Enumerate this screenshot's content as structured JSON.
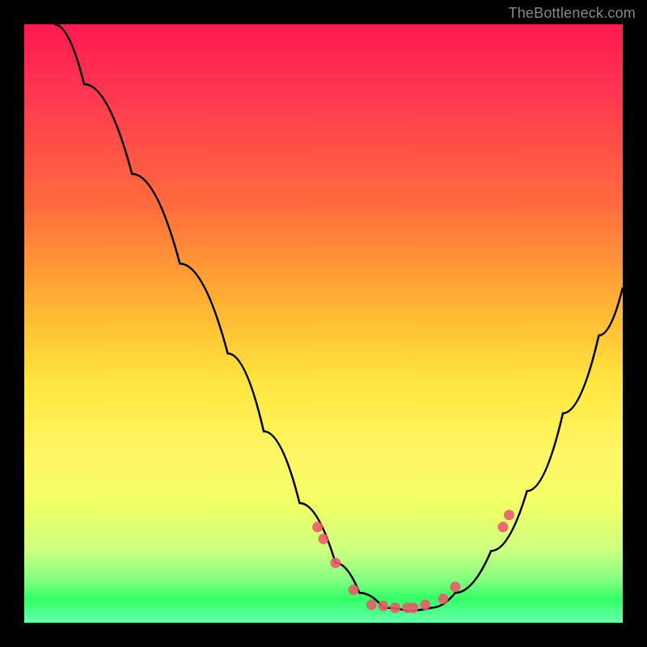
{
  "attribution": "TheBottleneck.com",
  "chart_data": {
    "type": "line",
    "title": "",
    "xlabel": "",
    "ylabel": "",
    "xlim": [
      0,
      100
    ],
    "ylim": [
      0,
      100
    ],
    "curve": [
      {
        "x": 5,
        "y": 100
      },
      {
        "x": 10,
        "y": 90
      },
      {
        "x": 18,
        "y": 75
      },
      {
        "x": 26,
        "y": 60
      },
      {
        "x": 34,
        "y": 45
      },
      {
        "x": 40,
        "y": 32
      },
      {
        "x": 46,
        "y": 20
      },
      {
        "x": 52,
        "y": 10
      },
      {
        "x": 56,
        "y": 5
      },
      {
        "x": 60,
        "y": 2.5
      },
      {
        "x": 64,
        "y": 2
      },
      {
        "x": 68,
        "y": 2.5
      },
      {
        "x": 72,
        "y": 5
      },
      {
        "x": 78,
        "y": 12
      },
      {
        "x": 84,
        "y": 22
      },
      {
        "x": 90,
        "y": 35
      },
      {
        "x": 96,
        "y": 48
      },
      {
        "x": 100,
        "y": 56
      }
    ],
    "markers": [
      {
        "x": 49,
        "y": 16
      },
      {
        "x": 50,
        "y": 14
      },
      {
        "x": 52,
        "y": 10
      },
      {
        "x": 55,
        "y": 5.5
      },
      {
        "x": 58,
        "y": 3
      },
      {
        "x": 60,
        "y": 2.8
      },
      {
        "x": 62,
        "y": 2.5
      },
      {
        "x": 64,
        "y": 2.5
      },
      {
        "x": 65,
        "y": 2.5
      },
      {
        "x": 67,
        "y": 3
      },
      {
        "x": 70,
        "y": 4
      },
      {
        "x": 72,
        "y": 6
      },
      {
        "x": 80,
        "y": 16
      },
      {
        "x": 81,
        "y": 18
      }
    ],
    "colors": {
      "curve": "#000000",
      "markers": "#e85a6a",
      "gradient_top": "#ff1a4d",
      "gradient_mid": "#ffe640",
      "gradient_bottom": "#33ff66"
    }
  }
}
